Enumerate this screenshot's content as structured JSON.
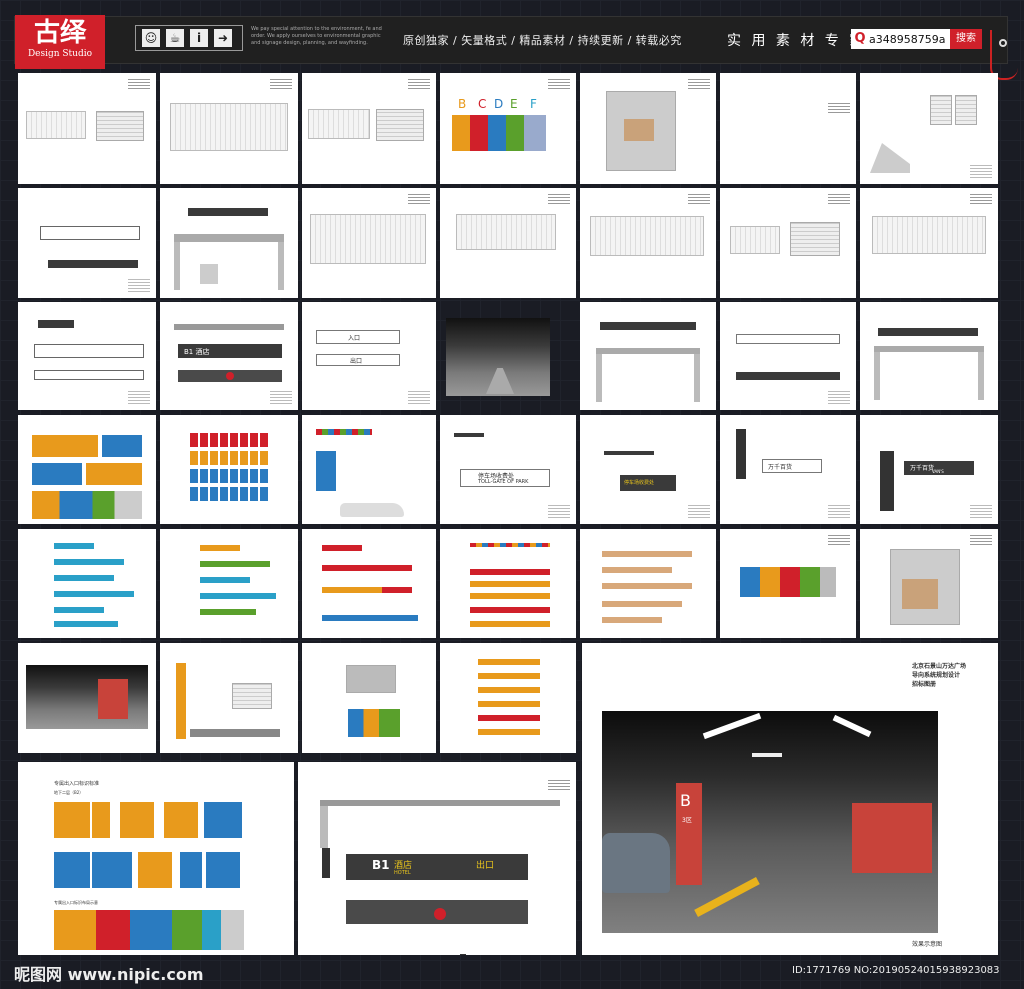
{
  "header": {
    "logo_text": "古绎",
    "logo_sub": "Design Studio",
    "tagline": "We pay special attention to the environment, fe and order. We apply ourselves to environmental graphic and signage design, planning, and wayfinding.",
    "slogan": "原创独家 / 矢量格式 / 精品素材 / 持续更新 / 转载必究",
    "expert": "实 用 素 材 专 家",
    "search_value": "a348958759a",
    "search_button": "搜索",
    "icons": [
      "person-icon",
      "coffee-icon",
      "info-icon",
      "exit-icon"
    ]
  },
  "thumbs": {
    "letters": [
      "B",
      "C",
      "D",
      "E",
      "F"
    ],
    "letter_colors": [
      "#e89a1c",
      "#d0202a",
      "#2a7bc0",
      "#5aa02c",
      "#2aa0c8"
    ],
    "sign_hotel": "B1 酒店",
    "sign_hotel_en": "HOTEL",
    "sign_exit": "出口",
    "toll": "停车场收费处",
    "toll_en": "TOLL-GATE OF PARK",
    "wanda": "万千百货",
    "wanda_en": "VAN'S",
    "entry": "入口",
    "exit_mark": "出口",
    "big_caption_1": "北京石景山万达广场",
    "big_caption_2": "导向系统规划设计",
    "big_caption_3": "招标图册",
    "big_title": "效果示意图",
    "pillar_letter": "B",
    "pillar_sub": "3区",
    "orange_title": "专属出入口标识标准",
    "orange_sub": "地下二层（B2）",
    "map_title": "专属出入口标识布局示意",
    "b1_label": "B1",
    "hotel_big": "酒店",
    "hotel_big_en": "HOTEL",
    "exit_big": "出口"
  },
  "footer": {
    "site": "昵图网 www.nipic.com",
    "id": "ID:1771769 NO:20190524015938923083"
  }
}
